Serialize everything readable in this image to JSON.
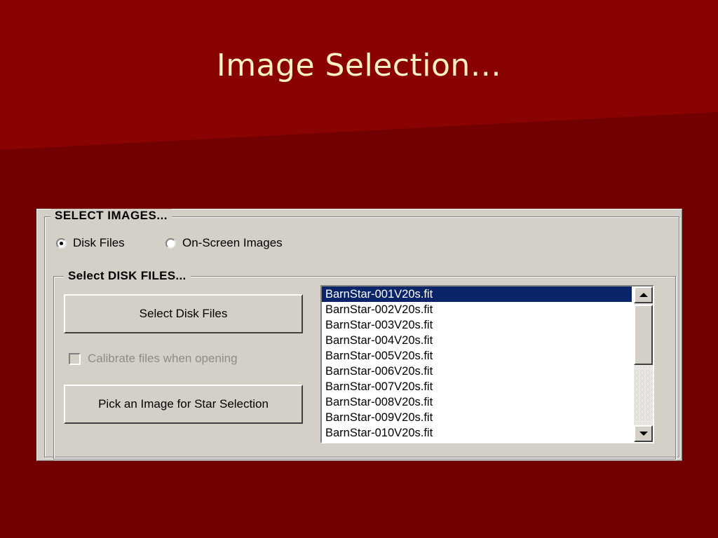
{
  "slide": {
    "title": "Image Selection…"
  },
  "dialog": {
    "outer_legend": "SELECT IMAGES...",
    "source_options": [
      {
        "label": "Disk Files",
        "checked": true
      },
      {
        "label": "On-Screen Images",
        "checked": false
      }
    ],
    "inner_legend": "Select DISK FILES...",
    "select_files_label": "Select Disk Files",
    "calibrate_label": "Calibrate files when opening",
    "calibrate_checked": false,
    "calibrate_enabled": false,
    "pick_image_label": "Pick an Image for Star Selection",
    "files": [
      "BarnStar-001V20s.fit",
      "BarnStar-002V20s.fit",
      "BarnStar-003V20s.fit",
      "BarnStar-004V20s.fit",
      "BarnStar-005V20s.fit",
      "BarnStar-006V20s.fit",
      "BarnStar-007V20s.fit",
      "BarnStar-008V20s.fit",
      "BarnStar-009V20s.fit",
      "BarnStar-010V20s.fit"
    ],
    "selected_file_index": 0
  },
  "colors": {
    "slide_background": "#7a0000",
    "title_text": "#fdf3c0",
    "dialog_face": "#d4d0c8",
    "selection": "#0a246a"
  },
  "icons": {
    "scroll_up": "scroll-up-arrow-icon",
    "scroll_down": "scroll-down-arrow-icon"
  }
}
